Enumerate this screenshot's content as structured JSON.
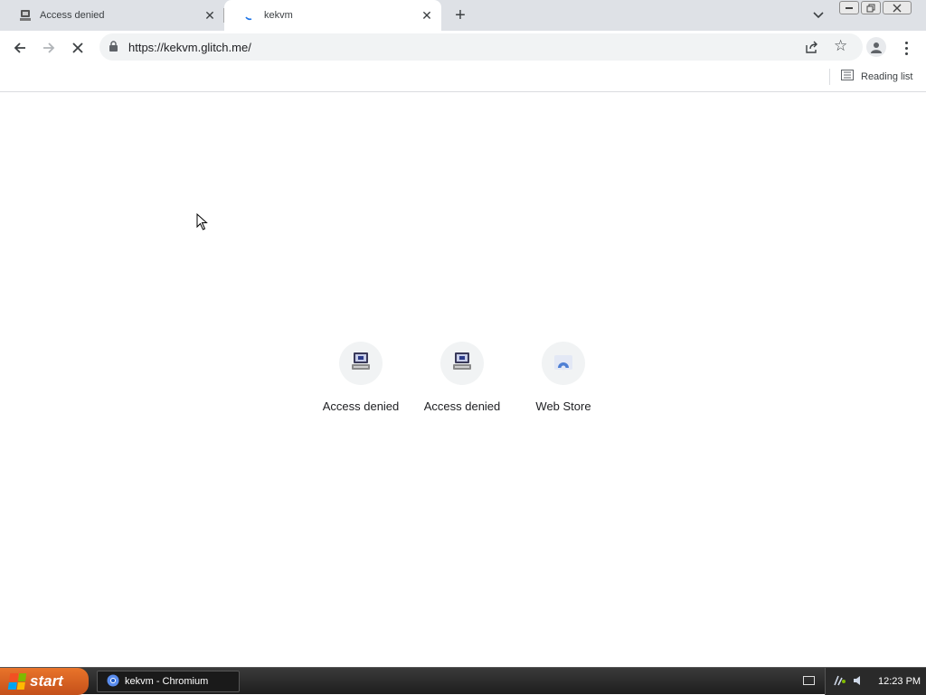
{
  "tabs": [
    {
      "title": "Access denied",
      "icon": "computer-icon"
    },
    {
      "title": "kekvm",
      "icon": "loading-spinner-icon",
      "active": true
    }
  ],
  "omnibox": {
    "url": "https://kekvm.glitch.me/"
  },
  "bookmarks_bar": {
    "reading_list_label": "Reading list"
  },
  "shortcuts": [
    {
      "label": "Access denied",
      "icon": "computer-icon"
    },
    {
      "label": "Access denied",
      "icon": "computer-icon"
    },
    {
      "label": "Web Store",
      "icon": "web-store-icon"
    }
  ],
  "taskbar": {
    "start_label": "start",
    "window_item": "kekvm - Chromium",
    "clock": "12:23 PM"
  },
  "colors": {
    "tab_strip": "#dee1e6",
    "omnibox": "#f1f3f4",
    "taskbar": "#2a2a2a",
    "start_button": "#d9622a"
  }
}
